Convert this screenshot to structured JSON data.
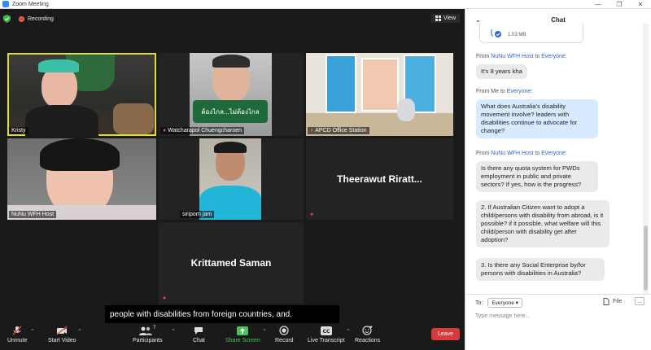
{
  "window": {
    "title": "Zoom Meeting"
  },
  "topbar": {
    "recording_label": "Recording",
    "view_label": "View"
  },
  "tiles": {
    "kristy": "Kristy",
    "watcharapol": "Watcharapol Chuengcharoen",
    "arcd": "APCD Office Station",
    "nunu": "NuNu WFH Host",
    "siriporn": "siriporn jam",
    "theerawut": "Theerawut  Riratt...",
    "krittamed": "Krittamed Saman"
  },
  "caption": {
    "text": "people with disabilities from foreign countries, and."
  },
  "toolbar": {
    "unmute": "Unmute",
    "start_video": "Start Video",
    "participants": "Participants",
    "participants_count": "7",
    "chat": "Chat",
    "share_screen": "Share Screen",
    "record": "Record",
    "live_transcript": "Live Transcript",
    "reactions": "Reactions",
    "leave": "Leave"
  },
  "chat": {
    "title": "Chat",
    "file_size": "1.03 MB",
    "messages": [
      {
        "from": "From",
        "sender": "NuNu WFH Host",
        "to_word": "to",
        "recipient": "Everyone:",
        "text": "It's 8 years kha"
      },
      {
        "from": "From",
        "sender": "Me",
        "to_word": "to",
        "recipient": "Everyone:",
        "text": "What does Australia's disability movement involve? leaders with disabilities continue to advocate for change?"
      },
      {
        "from": "From",
        "sender": "NuNu WFH Host",
        "to_word": "to",
        "recipient": "Everyone:",
        "text": "Is there any quota system for PWDs employment in public and private sectors? If yes, how is the progress?"
      },
      {
        "text": "2. If Australian Citizen want to adopt a child/persons with disability from abroad, is it possible? if it possible, what welfare will this child/person with disability get after adoption?"
      },
      {
        "text": "3. Is there any Social Enterprise by/for persons with disabilities in Australia?"
      }
    ],
    "footer": {
      "to_label": "To:",
      "recipient": "Everyone",
      "file_label": "File",
      "more_label": "...",
      "placeholder": "Type message here..."
    }
  },
  "colors": {
    "accent": "#2d8cff",
    "leave": "#d53b3b",
    "share": "#45c45a",
    "recording": "#e24b3c",
    "active_speaker": "#e0e020"
  }
}
